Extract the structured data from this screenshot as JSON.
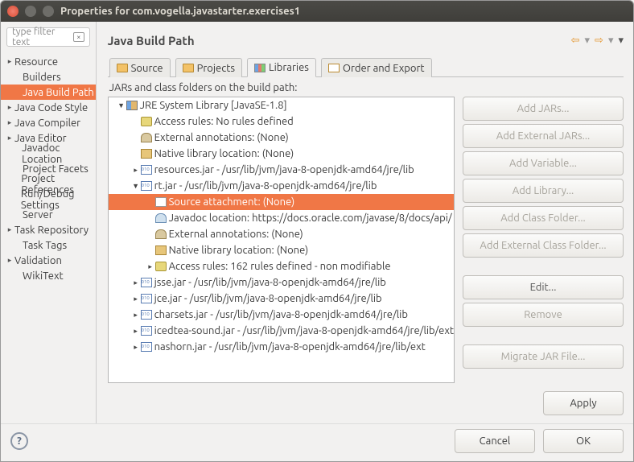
{
  "window": {
    "title": "Properties for com.vogella.javastarter.exercises1"
  },
  "filter": {
    "placeholder": "type filter text"
  },
  "nav": {
    "items": [
      {
        "label": "Resource",
        "expandable": true
      },
      {
        "label": "Builders",
        "expandable": false,
        "child": true
      },
      {
        "label": "Java Build Path",
        "expandable": false,
        "child": true,
        "selected": true
      },
      {
        "label": "Java Code Style",
        "expandable": true
      },
      {
        "label": "Java Compiler",
        "expandable": true
      },
      {
        "label": "Java Editor",
        "expandable": true
      },
      {
        "label": "Javadoc Location",
        "expandable": false,
        "child": true
      },
      {
        "label": "Project Facets",
        "expandable": false,
        "child": true
      },
      {
        "label": "Project References",
        "expandable": false,
        "child": true
      },
      {
        "label": "Run/Debug Settings",
        "expandable": false,
        "child": true
      },
      {
        "label": "Server",
        "expandable": false,
        "child": true
      },
      {
        "label": "Task Repository",
        "expandable": true
      },
      {
        "label": "Task Tags",
        "expandable": false,
        "child": true
      },
      {
        "label": "Validation",
        "expandable": true
      },
      {
        "label": "WikiText",
        "expandable": false,
        "child": true
      }
    ]
  },
  "main": {
    "title": "Java Build Path",
    "tabs": [
      {
        "label": "Source",
        "icon": "folder"
      },
      {
        "label": "Projects",
        "icon": "folder"
      },
      {
        "label": "Libraries",
        "icon": "books",
        "active": true
      },
      {
        "label": "Order and Export",
        "icon": "oe"
      }
    ],
    "subtitle": "JARs and class folders on the build path:"
  },
  "tree": [
    {
      "indent": 0,
      "tw": "▼",
      "icon": "lib",
      "label": "JRE System Library [JavaSE-1.8]"
    },
    {
      "indent": 1,
      "tw": "",
      "icon": "rule",
      "label": "Access rules: No rules defined"
    },
    {
      "indent": 1,
      "tw": "",
      "icon": "ann",
      "label": "External annotations: (None)"
    },
    {
      "indent": 1,
      "tw": "",
      "icon": "nl",
      "label": "Native library location: (None)"
    },
    {
      "indent": 1,
      "tw": "▸",
      "icon": "jar",
      "label": "resources.jar - /usr/lib/jvm/java-8-openjdk-amd64/jre/lib"
    },
    {
      "indent": 1,
      "tw": "▼",
      "icon": "jar",
      "label": "rt.jar - /usr/lib/jvm/java-8-openjdk-amd64/jre/lib"
    },
    {
      "indent": 2,
      "tw": "",
      "icon": "src",
      "label": "Source attachment: (None)",
      "selected": true
    },
    {
      "indent": 2,
      "tw": "",
      "icon": "doc",
      "label": "Javadoc location: https://docs.oracle.com/javase/8/docs/api/"
    },
    {
      "indent": 2,
      "tw": "",
      "icon": "ann",
      "label": "External annotations: (None)"
    },
    {
      "indent": 2,
      "tw": "",
      "icon": "nl",
      "label": "Native library location: (None)"
    },
    {
      "indent": 2,
      "tw": "▸",
      "icon": "rule",
      "label": "Access rules: 162 rules defined - non modifiable"
    },
    {
      "indent": 1,
      "tw": "▸",
      "icon": "jar",
      "label": "jsse.jar - /usr/lib/jvm/java-8-openjdk-amd64/jre/lib"
    },
    {
      "indent": 1,
      "tw": "▸",
      "icon": "jar",
      "label": "jce.jar - /usr/lib/jvm/java-8-openjdk-amd64/jre/lib"
    },
    {
      "indent": 1,
      "tw": "▸",
      "icon": "jar",
      "label": "charsets.jar - /usr/lib/jvm/java-8-openjdk-amd64/jre/lib"
    },
    {
      "indent": 1,
      "tw": "▸",
      "icon": "jar",
      "label": "icedtea-sound.jar - /usr/lib/jvm/java-8-openjdk-amd64/jre/lib/ext"
    },
    {
      "indent": 1,
      "tw": "▸",
      "icon": "jar",
      "label": "nashorn.jar - /usr/lib/jvm/java-8-openjdk-amd64/jre/lib/ext"
    }
  ],
  "buttons": {
    "add_jars": "Add JARs...",
    "add_ext_jars": "Add External JARs...",
    "add_var": "Add Variable...",
    "add_lib": "Add Library...",
    "add_cf": "Add Class Folder...",
    "add_ext_cf": "Add External Class Folder...",
    "edit": "Edit...",
    "remove": "Remove",
    "migrate": "Migrate JAR File...",
    "apply": "Apply",
    "cancel": "Cancel",
    "ok": "OK"
  }
}
